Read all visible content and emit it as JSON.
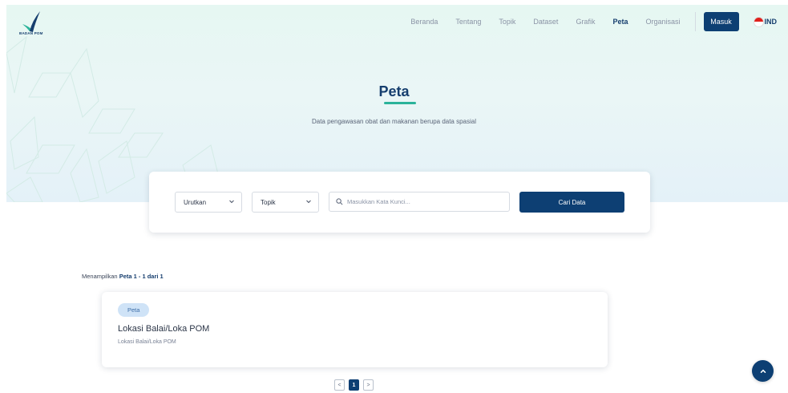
{
  "brand": {
    "logo_text": "BADAN POM"
  },
  "nav": {
    "items": [
      {
        "label": "Beranda",
        "active": false
      },
      {
        "label": "Tentang",
        "active": false
      },
      {
        "label": "Topik",
        "active": false
      },
      {
        "label": "Dataset",
        "active": false
      },
      {
        "label": "Grafik",
        "active": false
      },
      {
        "label": "Peta",
        "active": true
      },
      {
        "label": "Organisasi",
        "active": false
      }
    ],
    "login_label": "Masuk",
    "language_label": "IND"
  },
  "hero": {
    "title": "Peta",
    "subtitle": "Data pengawasan obat dan makanan berupa data spasial"
  },
  "search": {
    "sort_label": "Urutkan",
    "topic_label": "Topik",
    "keyword_placeholder": "Masukkan Kata Kunci...",
    "submit_label": "Cari Data"
  },
  "results": {
    "summary_prefix": "Menampilkan ",
    "summary_bold": "Peta 1 - 1 dari 1",
    "items": [
      {
        "badge": "Peta",
        "title": "Lokasi Balai/Loka POM",
        "description": "Lokasi Balai/Loka POM"
      }
    ]
  },
  "pagination": {
    "prev": "<",
    "current": "1",
    "next": ">"
  },
  "colors": {
    "primary": "#0d3f73",
    "accent": "#2bb39a",
    "hero_bg": "#e6f7f2",
    "badge_bg": "#cfe3f7"
  },
  "icons": [
    "search-icon",
    "chevron-down-icon",
    "chevron-up-icon",
    "indonesia-flag-icon"
  ]
}
